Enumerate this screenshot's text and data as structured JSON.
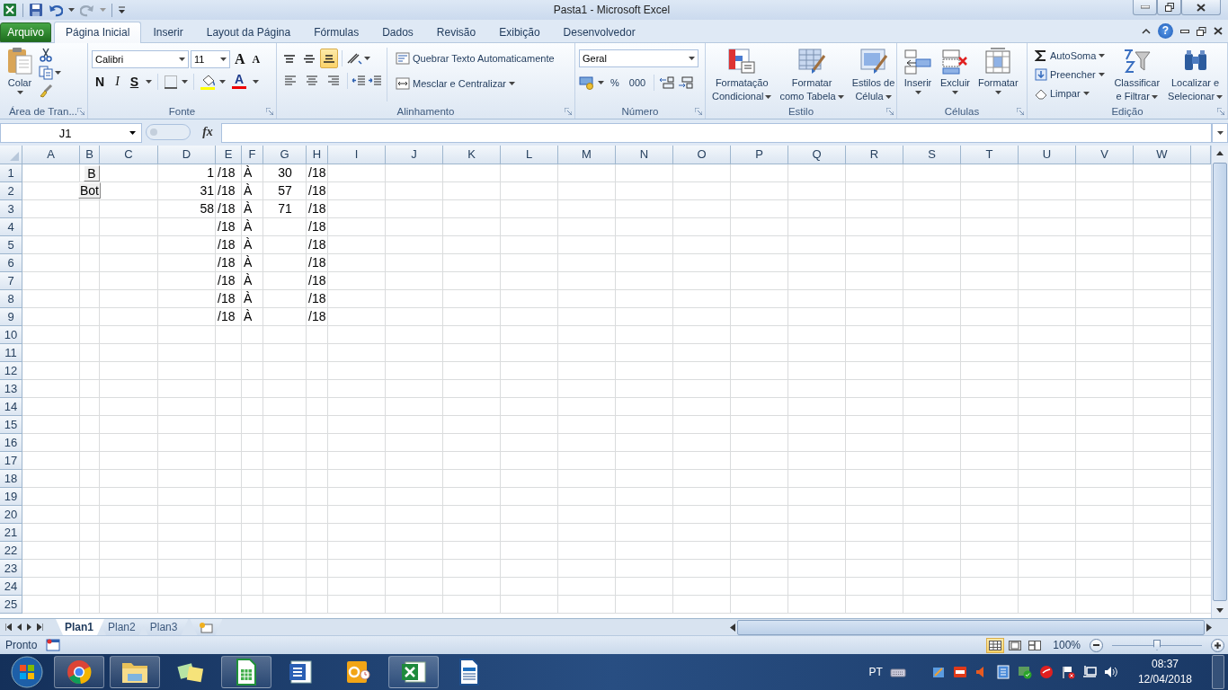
{
  "title_bar": {
    "title": "Pasta1 - Microsoft Excel"
  },
  "file_tab": {
    "label": "Arquivo"
  },
  "tabs": [
    {
      "label": "Página Inicial",
      "selected": true
    },
    {
      "label": "Inserir",
      "selected": false
    },
    {
      "label": "Layout da Página",
      "selected": false
    },
    {
      "label": "Fórmulas",
      "selected": false
    },
    {
      "label": "Dados",
      "selected": false
    },
    {
      "label": "Revisão",
      "selected": false
    },
    {
      "label": "Exibição",
      "selected": false
    },
    {
      "label": "Desenvolvedor",
      "selected": false
    }
  ],
  "help": {
    "label": "?"
  },
  "ribbon": {
    "clipboard": {
      "label": "Área de Tran...",
      "paste": "Colar"
    },
    "font": {
      "label": "Fonte",
      "font_name": "Calibri",
      "font_size": "11",
      "grow": "A",
      "shrink": "A",
      "bold": "N",
      "italic": "I",
      "underline": "S",
      "font_color": "A"
    },
    "alignment": {
      "label": "Alinhamento",
      "vertical": [
        {
          "selected": false
        },
        {
          "selected": false
        },
        {
          "selected": true
        }
      ],
      "wrap": "Quebrar Texto Automaticamente",
      "merge": "Mesclar e Centralizar"
    },
    "number": {
      "label": "Número",
      "format": "Geral",
      "percent": "%",
      "thousands": "000"
    },
    "styles": {
      "label": "Estilo",
      "buttons": [
        {
          "kind": "conditional",
          "lines": [
            "Formatação",
            "Condicional"
          ]
        },
        {
          "kind": "table",
          "lines": [
            "Formatar",
            "como Tabela"
          ]
        },
        {
          "kind": "cell",
          "lines": [
            "Estilos de",
            "Célula"
          ]
        }
      ]
    },
    "cells": {
      "label": "Células",
      "buttons": [
        {
          "kind": "insert",
          "label": "Inserir"
        },
        {
          "kind": "delete",
          "label": "Excluir"
        },
        {
          "kind": "format",
          "label": "Formatar"
        }
      ]
    },
    "editing": {
      "label": "Edição",
      "small": [
        {
          "kind": "sum",
          "label": "AutoSoma"
        },
        {
          "kind": "fill",
          "label": "Preencher"
        },
        {
          "kind": "clear",
          "label": "Limpar"
        }
      ],
      "buttons": [
        {
          "kind": "sort",
          "lines": [
            "Classificar",
            "e Filtrar"
          ]
        },
        {
          "kind": "find",
          "lines": [
            "Localizar e",
            "Selecionar"
          ]
        }
      ]
    }
  },
  "formula_bar": {
    "name_box": "J1",
    "function_label": "fx"
  },
  "columns": [
    "A",
    "B",
    "C",
    "D",
    "E",
    "F",
    "G",
    "H",
    "I",
    "J",
    "K",
    "L",
    "M",
    "N",
    "O",
    "P",
    "Q",
    "R",
    "S",
    "T",
    "U",
    "V",
    "W"
  ],
  "rows": [
    {
      "header": "1",
      "cells": [
        null,
        null,
        null,
        "1",
        "/18",
        "À",
        "30",
        "/18"
      ]
    },
    {
      "header": "2",
      "cells": [
        null,
        null,
        null,
        "31",
        "/18",
        "À",
        "57",
        "/18"
      ]
    },
    {
      "header": "3",
      "cells": [
        null,
        null,
        null,
        "58",
        "/18",
        "À",
        "71",
        "/18"
      ]
    },
    {
      "header": "4",
      "cells": [
        null,
        null,
        null,
        null,
        "/18",
        "À",
        null,
        "/18"
      ]
    },
    {
      "header": "5",
      "cells": [
        null,
        null,
        null,
        null,
        "/18",
        "À",
        null,
        "/18"
      ]
    },
    {
      "header": "6",
      "cells": [
        null,
        null,
        null,
        null,
        "/18",
        "À",
        null,
        "/18"
      ]
    },
    {
      "header": "7",
      "cells": [
        null,
        null,
        null,
        null,
        "/18",
        "À",
        null,
        "/18"
      ]
    },
    {
      "header": "8",
      "cells": [
        null,
        null,
        null,
        null,
        "/18",
        "À",
        null,
        "/18"
      ]
    },
    {
      "header": "9",
      "cells": [
        null,
        null,
        null,
        null,
        "/18",
        "À",
        null,
        "/18"
      ]
    },
    {
      "header": "10"
    },
    {
      "header": "11"
    },
    {
      "header": "12"
    },
    {
      "header": "13"
    },
    {
      "header": "14"
    },
    {
      "header": "15"
    },
    {
      "header": "16"
    },
    {
      "header": "17"
    },
    {
      "header": "18"
    },
    {
      "header": "19"
    },
    {
      "header": "20"
    },
    {
      "header": "21"
    },
    {
      "header": "22"
    },
    {
      "header": "23"
    },
    {
      "header": "24"
    },
    {
      "header": "25"
    }
  ],
  "form_buttons": [
    {
      "label": "B"
    },
    {
      "label": "Bot"
    }
  ],
  "sheet_tabs": [
    {
      "label": "Plan1",
      "selected": true
    },
    {
      "label": "Plan2",
      "selected": false
    },
    {
      "label": "Plan3",
      "selected": false
    }
  ],
  "status_bar": {
    "status": "Pronto",
    "views": [
      {
        "kind": "normal",
        "selected": true
      },
      {
        "kind": "layout",
        "selected": false
      },
      {
        "kind": "page_break",
        "selected": false
      }
    ],
    "zoom": "100%",
    "zoom_slider": {
      "level": 0.5
    }
  },
  "taskbar": {
    "apps": [
      {
        "kind": "chrome",
        "running": true
      },
      {
        "kind": "folder",
        "running": true
      },
      {
        "kind": "notes",
        "running": false
      },
      {
        "kind": "calc",
        "running": true
      },
      {
        "kind": "word",
        "running": false
      },
      {
        "kind": "outlook",
        "running": false
      },
      {
        "kind": "excel",
        "running": true
      },
      {
        "kind": "writer",
        "running": false
      }
    ],
    "language": "PT",
    "time": "08:37",
    "date": "12/04/2018"
  }
}
